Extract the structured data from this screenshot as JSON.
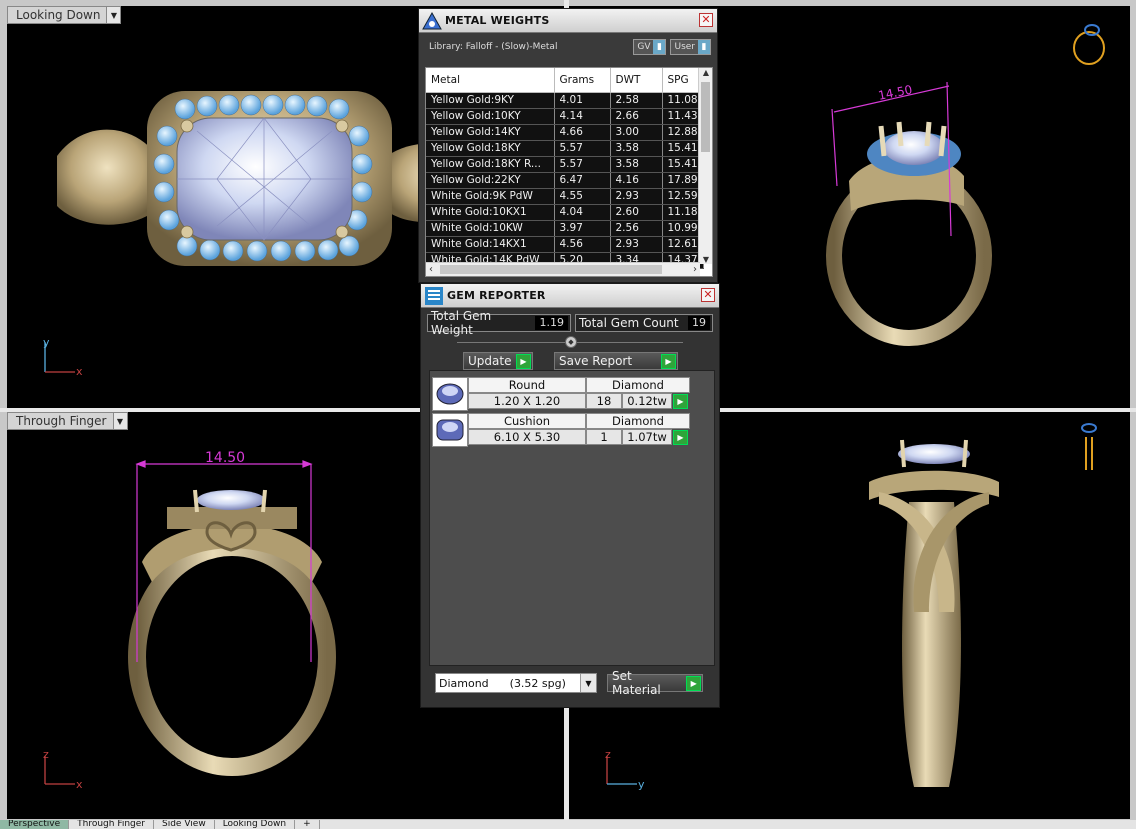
{
  "viewports": {
    "top_left": {
      "label": "Looking Down",
      "axis_y": "y",
      "axis_x": "x"
    },
    "bottom_left": {
      "label": "Through Finger",
      "dimension": "14.50",
      "axis_y": "z",
      "axis_x": "x"
    },
    "top_right": {
      "dimension": "14.50"
    },
    "bottom_right": {
      "axis_y": "z",
      "axis_x": "y"
    }
  },
  "tabs": [
    "Perspective",
    "Through Finger",
    "Side View",
    "Looking Down",
    "+"
  ],
  "metal_weights": {
    "title": "METAL WEIGHTS",
    "library": "Library: Falloff - (Slow)-Metal",
    "gv_label": "GV",
    "user_label": "User",
    "columns": [
      "Metal",
      "Grams",
      "DWT",
      "SPG"
    ],
    "rows": [
      [
        "Yellow Gold:9KY",
        "4.01",
        "2.58",
        "11.08"
      ],
      [
        "Yellow Gold:10KY",
        "4.14",
        "2.66",
        "11.43"
      ],
      [
        "Yellow Gold:14KY",
        "4.66",
        "3.00",
        "12.88"
      ],
      [
        "Yellow Gold:18KY",
        "5.57",
        "3.58",
        "15.41"
      ],
      [
        "Yellow Gold:18KY R...",
        "5.57",
        "3.58",
        "15.41"
      ],
      [
        "Yellow Gold:22KY",
        "6.47",
        "4.16",
        "17.89"
      ],
      [
        "White Gold:9K PdW",
        "4.55",
        "2.93",
        "12.59"
      ],
      [
        "White Gold:10KX1",
        "4.04",
        "2.60",
        "11.18"
      ],
      [
        "White Gold:10KW",
        "3.97",
        "2.56",
        "10.99"
      ],
      [
        "White Gold:14KX1",
        "4.56",
        "2.93",
        "12.61"
      ],
      [
        "White Gold:14K PdW",
        "5.20",
        "3.34",
        "14.37"
      ]
    ]
  },
  "gem_reporter": {
    "title": "GEM REPORTER",
    "total_weight_label": "Total Gem Weight",
    "total_weight": "1.19",
    "total_count_label": "Total Gem Count",
    "total_count": "19",
    "update_label": "Update",
    "save_label": "Save Report",
    "gems": [
      {
        "shape": "Round",
        "material": "Diamond",
        "size": "1.20 X 1.20",
        "count": "18",
        "weight": "0.12tw"
      },
      {
        "shape": "Cushion",
        "material": "Diamond",
        "size": "6.10 X 5.30",
        "count": "1",
        "weight": "1.07tw"
      }
    ],
    "material_select": "Diamond      (3.52 spg)",
    "set_material_label": "Set Material"
  },
  "colors": {
    "dimension": "#d63ad6",
    "gold": "#c9b58a",
    "gem": "#a9cfee"
  }
}
